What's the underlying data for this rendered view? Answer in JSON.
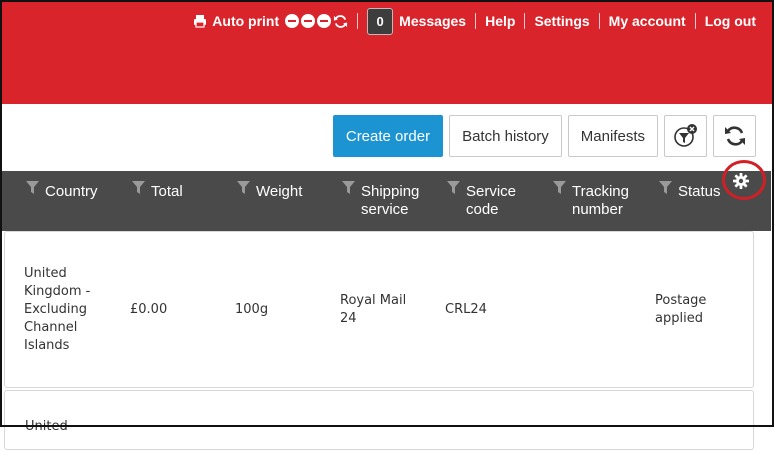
{
  "header": {
    "autoprint_label": "Auto print",
    "message_count": "0",
    "links": [
      "Messages",
      "Help",
      "Settings",
      "My account",
      "Log out"
    ],
    "brand_color": "#d9242b"
  },
  "toolbar": {
    "create_order": "Create order",
    "batch_history": "Batch history",
    "manifests": "Manifests",
    "icons": [
      "filter-clear-icon",
      "refresh-icon"
    ],
    "primary_color": "#1c94d2"
  },
  "table": {
    "columns": [
      "Country",
      "Total",
      "Weight",
      "Shipping\nservice",
      "Service\ncode",
      "Tracking\nnumber",
      "Status"
    ],
    "rows": [
      {
        "country": "United\nKingdom -\nExcluding\nChannel\nIslands",
        "total": "£0.00",
        "weight": "100g",
        "shipping_service": "Royal Mail\n24",
        "service_code": "CRL24",
        "tracking_number": "",
        "status": "Postage\napplied"
      }
    ],
    "partial_row_text": "United"
  }
}
